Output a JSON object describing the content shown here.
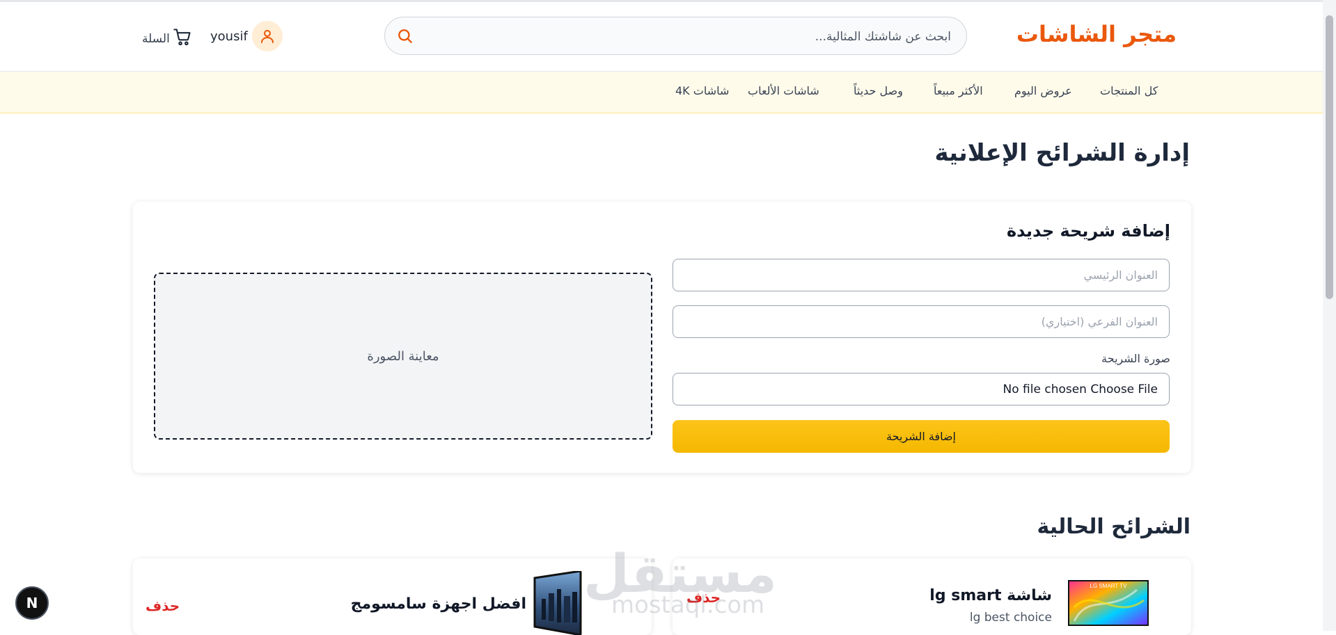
{
  "header": {
    "brand": "متجر الشاشات",
    "search_placeholder": "ابحث عن شاشتك المثالية...",
    "username": "yousif",
    "cart_label": "السلة"
  },
  "nav": {
    "items": [
      "كل المنتجات",
      "عروض اليوم",
      "الأكثر مبيعاً",
      "وصل حديثاً",
      "شاشات الألعاب",
      "شاشات 4K"
    ]
  },
  "page": {
    "title": "إدارة الشرائح الإعلانية"
  },
  "form": {
    "title": "إضافة شريحة جديدة",
    "title_placeholder": "العنوان الرئيسي",
    "subtitle_placeholder": "العنوان الفرعي (اختياري)",
    "image_label": "صورة الشريحة",
    "file_status": "No file chosen",
    "file_button": "Choose File",
    "submit_label": "إضافة الشريحة",
    "preview_label": "معاينة الصورة"
  },
  "current": {
    "title": "الشرائح الحالية",
    "slides": [
      {
        "title": "شاشة lg smart",
        "subtitle": "lg best choice",
        "thumb_text": "LG SMART TV",
        "delete_label": "حذف"
      },
      {
        "title": "افضل اجهزة سامسومج",
        "subtitle": "",
        "delete_label": "حذف"
      }
    ]
  },
  "fab": {
    "label": "N"
  },
  "watermark": {
    "arabic": "مستقل",
    "latin": "mostaql.com"
  },
  "colors": {
    "brand": "#ea580c",
    "accent": "#f5b800",
    "nav_bg": "#fffbeb",
    "danger": "#dc2626"
  }
}
